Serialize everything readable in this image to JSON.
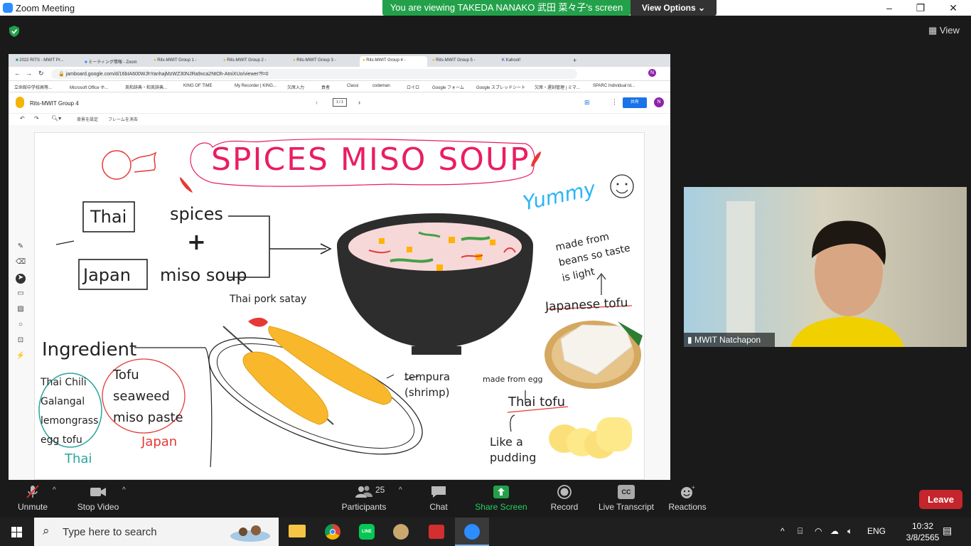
{
  "window": {
    "title": "Zoom Meeting"
  },
  "banner": {
    "viewing": "You are viewing TAKEDA NANAKO 武田 菜々子's screen",
    "view_options": "View Options"
  },
  "top_right": {
    "view": "View"
  },
  "browser": {
    "tabs": [
      "2022 RITS - MWIT Pr...",
      "ミーティング情報 - Zoom",
      "Rits-MWIT Group 1 -",
      "Rits-MWIT Group 2 -",
      "Rits-MWIT Group 3 -",
      "Rits-MWIT Group 4 -",
      "Rits-MWIT Group 5 -",
      "Kahoot!"
    ],
    "url": "jamboard.google.com/d/16bIA600WJhYanhajMzWZ30NJRa9xca2NtOh-AtniXUo/viewer?f=0",
    "bookmarks": [
      "立命館中学校高等...",
      "Microsoft Office ホ...",
      "英和辞典・和英辞典...",
      "KING OF TIME",
      "My Recorder | KING...",
      "欠席入力",
      "貢者",
      "Classi",
      "codeman",
      "ロイロ",
      "Google フォーム",
      "Google スプレッドシート",
      "欠席・遅刻管理 | ミマ...",
      "SPARC Individual Id..."
    ]
  },
  "jamboard": {
    "doc_title": "Rits-MWIT Group 4",
    "frame": "1 / 1",
    "share": "共有",
    "avatar": "N",
    "tools": {
      "set_bg": "背景を設定",
      "clear_frame": "フレームを消去"
    }
  },
  "drawing": {
    "title": "SPICES MISO SOUP",
    "yummy": "Yummy",
    "thai": "Thai",
    "japan": "Japan",
    "spices": "spices",
    "plus": "+",
    "miso_soup": "miso soup",
    "pork_satay": "Thai pork satay",
    "tempura": "tempura (shrimp)",
    "ingredient": "Ingredient",
    "thai_list": [
      "Thai Chili",
      "Galangal",
      "lemongrass",
      "egg tofu"
    ],
    "japan_list": [
      "Tofu",
      "seaweed",
      "miso paste"
    ],
    "thai_label": "Thai",
    "japan_label": "Japan",
    "made_from_beans": "made from beans so taste is light",
    "japanese_tofu": "Japanese tofu",
    "made_from_egg": "made from egg",
    "thai_tofu": "Thai tofu",
    "like_pudding": "Like a pudding"
  },
  "video": {
    "participant": "MWIT Natchapon"
  },
  "toolbar": {
    "unmute": "Unmute",
    "stop_video": "Stop Video",
    "participants": "Participants",
    "participants_count": "25",
    "chat": "Chat",
    "share_screen": "Share Screen",
    "record": "Record",
    "live_transcript": "Live Transcript",
    "cc": "CC",
    "reactions": "Reactions",
    "leave": "Leave"
  },
  "taskbar": {
    "search_placeholder": "Type here to search",
    "lang": "ENG",
    "time": "10:32",
    "date": "3/8/2565"
  },
  "colors": {
    "zoom_green": "#23a14a",
    "leave_red": "#c5252c",
    "zoom_blue": "#2d8cff"
  }
}
